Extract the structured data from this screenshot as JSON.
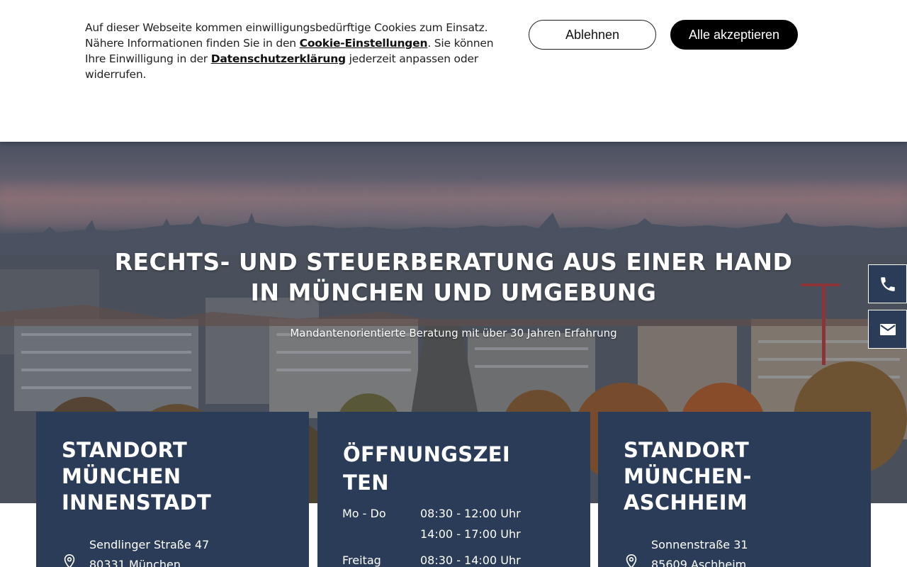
{
  "cookie_banner": {
    "text_part1": "Auf dieser Webseite kommen einwilligungsbedürftige Cookies zum Einsatz. Nähere Informationen finden Sie in den ",
    "cookie_settings_link": "Cookie-Einstellungen",
    "text_part2": ". Sie können Ihre Einwilligung in der ",
    "privacy_link": "Datenschutzerklärung",
    "text_part3": " jederzeit anpassen oder widerrufen.",
    "decline_label": "Ablehnen",
    "accept_label": "Alle akzeptieren"
  },
  "hero": {
    "title": "RECHTS- UND STEUERBERATUNG AUS EINER HAND IN MÜNCHEN UND UMGEBUNG",
    "subtitle": "Mandantenorientierte Beratung mit über 30 Jahren Erfahrung"
  },
  "side_contact": {
    "phone_icon": "phone-icon",
    "mail_icon": "mail-icon"
  },
  "cards": {
    "location_1": {
      "title": "STANDORT MÜNCHEN INNENSTADT",
      "street": "Sendlinger Straße 47",
      "city": "80331 München",
      "icon": "location-pin-icon"
    },
    "hours": {
      "title": "ÖFFNUNGSZEI TEN",
      "row1_day": "Mo - Do",
      "row1_time1": "08:30 - 12:00 Uhr",
      "row1_time2": "14:00 - 17:00 Uhr",
      "row2_day": "Freitag",
      "row2_time1": "08:30 - 14:00 Uhr"
    },
    "location_2": {
      "title": "STANDORT MÜNCHEN-ASCHHEIM",
      "street": "Sonnenstraße 31",
      "city": "85609 Aschheim",
      "icon": "location-pin-icon"
    }
  },
  "colors": {
    "card_bg": "#2b3c58",
    "accept_bg": "#000000"
  }
}
